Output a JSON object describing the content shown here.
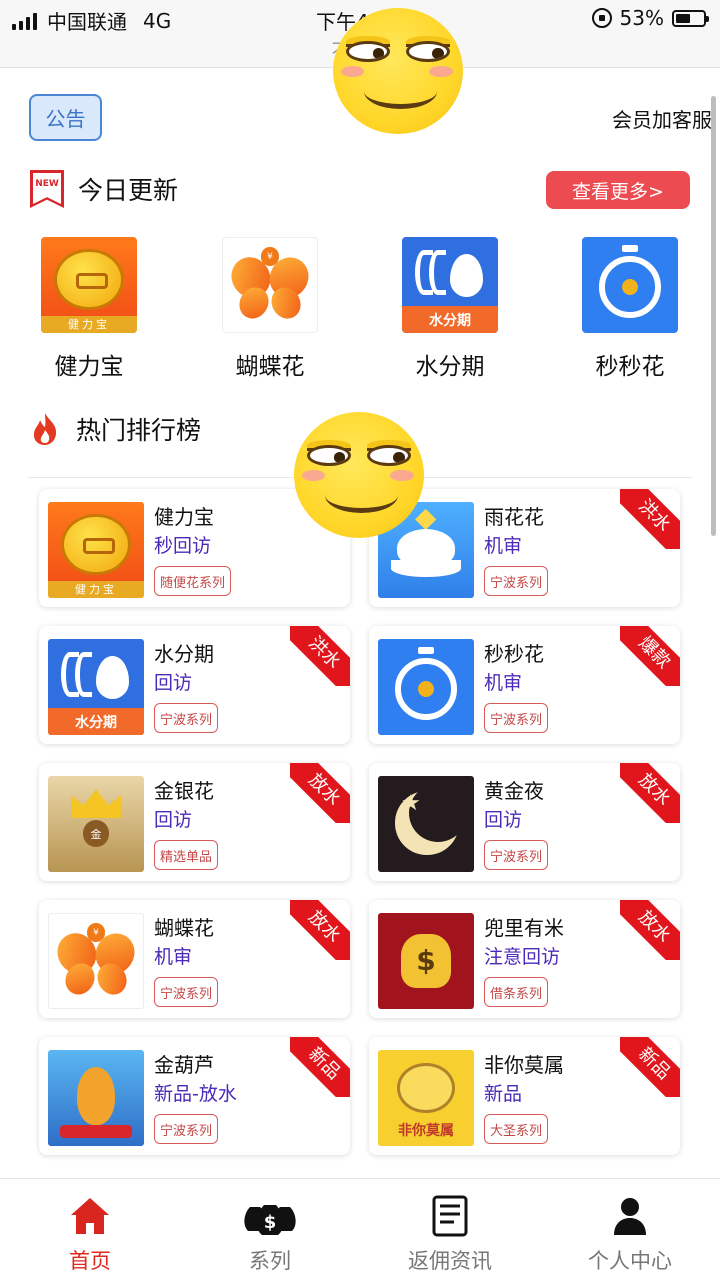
{
  "status_bar": {
    "carrier": "中国联通",
    "network": "4G",
    "time": "下午4",
    "battery": "53%",
    "battery_level": 0.53
  },
  "address_bar": {
    "text": "不安全"
  },
  "top": {
    "notice_label": "公告",
    "member_link": "会员加客服"
  },
  "today": {
    "badge": "NEW",
    "title": "今日更新",
    "more_label": "查看更多>",
    "apps": [
      {
        "name": "健力宝",
        "icon": "jianlibao-icon"
      },
      {
        "name": "蝴蝶花",
        "icon": "hudiehua-icon"
      },
      {
        "name": "水分期",
        "icon": "shuifenqi-icon"
      },
      {
        "name": "秒秒花",
        "icon": "miaomiaohua-icon"
      }
    ]
  },
  "hot": {
    "title": "热门排行榜",
    "cards": [
      {
        "name": "健力宝",
        "tag": "秒回访",
        "series": "随便花系列",
        "ribbon": "",
        "icon": "jianlibao-icon"
      },
      {
        "name": "雨花花",
        "tag": "机审",
        "series": "宁波系列",
        "ribbon": "洪水",
        "icon": "yuhuahua-icon"
      },
      {
        "name": "水分期",
        "tag": "回访",
        "series": "宁波系列",
        "ribbon": "洪水",
        "icon": "shuifenqi-icon"
      },
      {
        "name": "秒秒花",
        "tag": "机审",
        "series": "宁波系列",
        "ribbon": "爆款",
        "icon": "miaomiaohua-icon"
      },
      {
        "name": "金银花",
        "tag": "回访",
        "series": "精选单品",
        "ribbon": "放水",
        "icon": "jinyinhua-icon"
      },
      {
        "name": "黄金夜",
        "tag": "回访",
        "series": "宁波系列",
        "ribbon": "放水",
        "icon": "huangjinye-icon"
      },
      {
        "name": "蝴蝶花",
        "tag": "机审",
        "series": "宁波系列",
        "ribbon": "放水",
        "icon": "hudiehua-icon"
      },
      {
        "name": "兜里有米",
        "tag": "注意回访",
        "series": "借条系列",
        "ribbon": "放水",
        "icon": "doumiyoumi-icon"
      },
      {
        "name": "金葫芦",
        "tag": "新品-放水",
        "series": "宁波系列",
        "ribbon": "新品",
        "icon": "jinhulu-icon"
      },
      {
        "name": "非你莫属",
        "tag": "新品",
        "series": "大圣系列",
        "ribbon": "新品",
        "icon": "feinimoshu-icon"
      }
    ],
    "icon_text": {
      "jianlibao": "健力宝",
      "shuifenqi": "水分期",
      "jinyinhua": "金",
      "feinimoshu": "非你莫属"
    }
  },
  "tabbar": {
    "items": [
      {
        "label": "首页",
        "icon": "home-icon",
        "active": true
      },
      {
        "label": "系列",
        "icon": "money-bags-icon",
        "active": false
      },
      {
        "label": "返佣资讯",
        "icon": "document-icon",
        "active": false
      },
      {
        "label": "个人中心",
        "icon": "user-icon",
        "active": false
      }
    ]
  },
  "colors": {
    "accent_red": "#e0281f",
    "more_button": "#ec4b52",
    "tag_purple": "#4a2bb8",
    "notice_blue": "#4a86d6"
  }
}
